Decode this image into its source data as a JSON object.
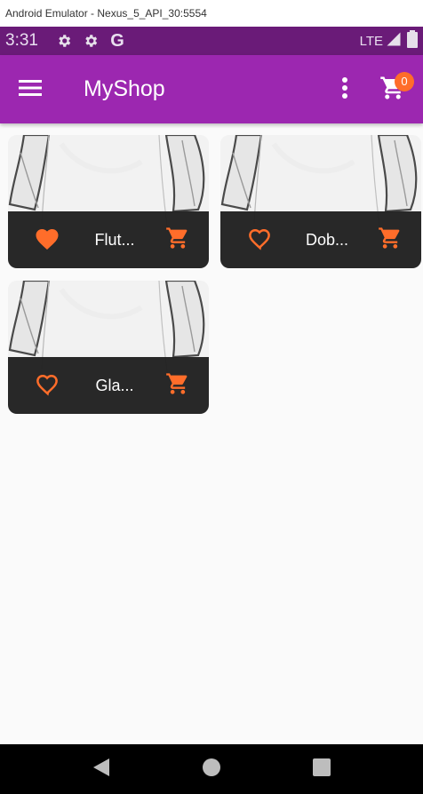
{
  "window": {
    "title": "Android Emulator - Nexus_5_API_30:5554"
  },
  "status_bar": {
    "time": "3:31",
    "icons": [
      "gear-icon",
      "gear-icon",
      "google-g-icon"
    ],
    "google_letter": "G",
    "network": "LTE",
    "right_icons": [
      "signal-icon",
      "battery-icon"
    ]
  },
  "app_bar": {
    "title": "MyShop",
    "menu_icon": "hamburger-menu-icon",
    "more_icon": "more-vert-icon",
    "cart_icon": "shopping-cart-icon",
    "cart_count": "0"
  },
  "colors": {
    "status_bar": "#6a1b78",
    "app_bar": "#9c27b0",
    "accent": "#ff6d2a",
    "card_footer": "#212121",
    "background": "#fafafa"
  },
  "products": [
    {
      "title": "Flut...",
      "favorite": true
    },
    {
      "title": "Dob...",
      "favorite": false
    },
    {
      "title": "Gla...",
      "favorite": false
    }
  ],
  "nav_bar": {
    "buttons": [
      "back-icon",
      "home-icon",
      "recents-icon"
    ]
  }
}
